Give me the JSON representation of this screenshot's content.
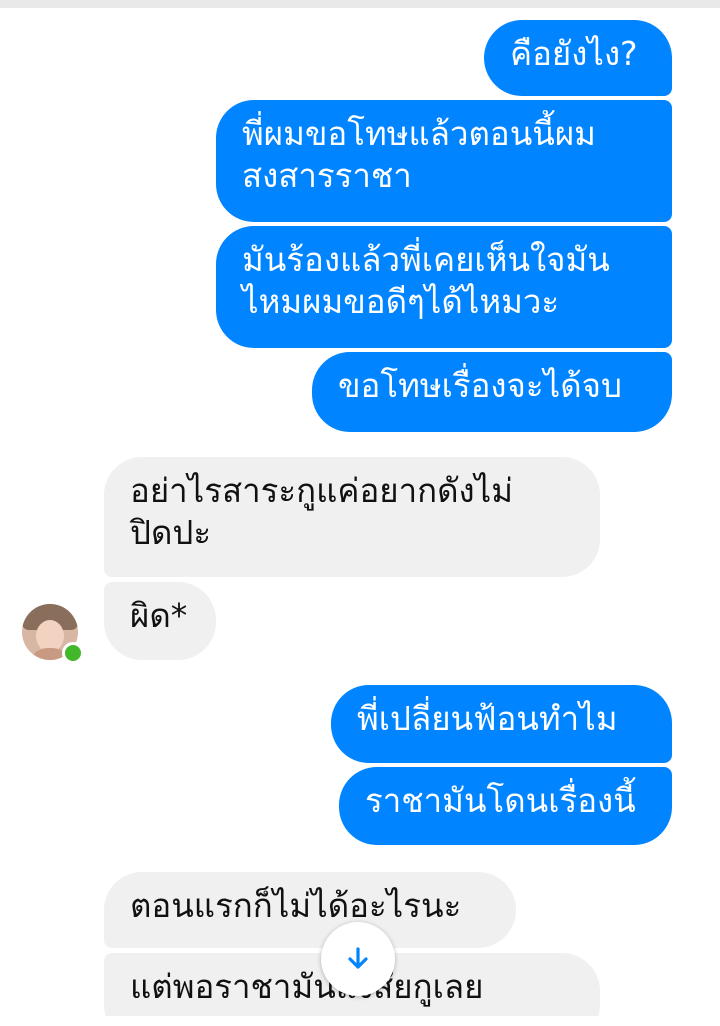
{
  "chat": {
    "messages": [
      {
        "side": "out",
        "text": "คือยังไง?"
      },
      {
        "side": "out",
        "text": "พี่ผมขอโทษแล้วตอนนี้ผม\nสงสารราชา"
      },
      {
        "side": "out",
        "text": "มันร้องแล้วพี่เคยเห็นใจมัน\nไหมผมขอดีๆได้ไหมวะ"
      },
      {
        "side": "out",
        "text": "ขอโทษเรื่องจะได้จบ"
      },
      {
        "side": "in",
        "text": "อย่าไรสาระกูแค่อยากดังไม่\nปิดปะ"
      },
      {
        "side": "in",
        "text": "ผิด*"
      },
      {
        "side": "out",
        "text": "พี่เปลี่ยนฟ้อนทำไม"
      },
      {
        "side": "out",
        "text": "ราชามันโดนเรื่องนี้"
      },
      {
        "side": "in",
        "text": "ตอนแรกก็ไม่ได้อะไรนะ"
      },
      {
        "side": "in",
        "text": "แต่พอราชามันแงสัยกูเลย"
      }
    ]
  },
  "colors": {
    "outgoing_bubble": "#0084ff",
    "incoming_bubble": "#f0f0f0",
    "online": "#42b72a"
  },
  "icons": {
    "scroll_down": "arrow-down-icon",
    "status": "online-dot-icon"
  }
}
